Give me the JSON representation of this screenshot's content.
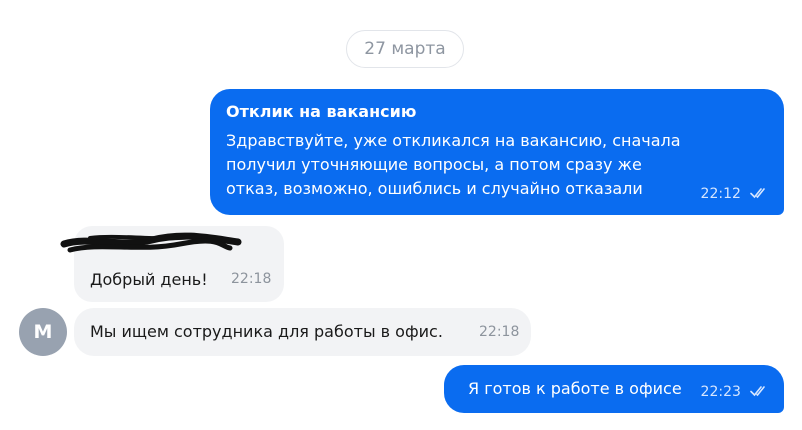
{
  "date_separator": "27 марта",
  "messages": [
    {
      "direction": "outgoing",
      "title": "Отклик на вакансию",
      "text": "Здравствуйте, уже откликался на вакансию, сначала получил уточняющие вопросы, а потом сразу же отказ, возможно, ошиблись и случайно отказали",
      "time": "22:12",
      "status_icon": "double-check-icon"
    },
    {
      "direction": "incoming",
      "sender_name_redacted": true,
      "text": "Добрый день!",
      "time": "22:18"
    },
    {
      "direction": "incoming",
      "avatar_letter": "М",
      "text": "Мы ищем сотрудника для работы в офис.",
      "time": "22:18"
    },
    {
      "direction": "outgoing",
      "text": "Я готов к работе в офисе",
      "time": "22:23",
      "status_icon": "double-check-icon"
    }
  ],
  "colors": {
    "outgoing_bubble": "#0a6cf0",
    "incoming_bubble": "#f2f3f5",
    "avatar": "#98a2b0"
  }
}
